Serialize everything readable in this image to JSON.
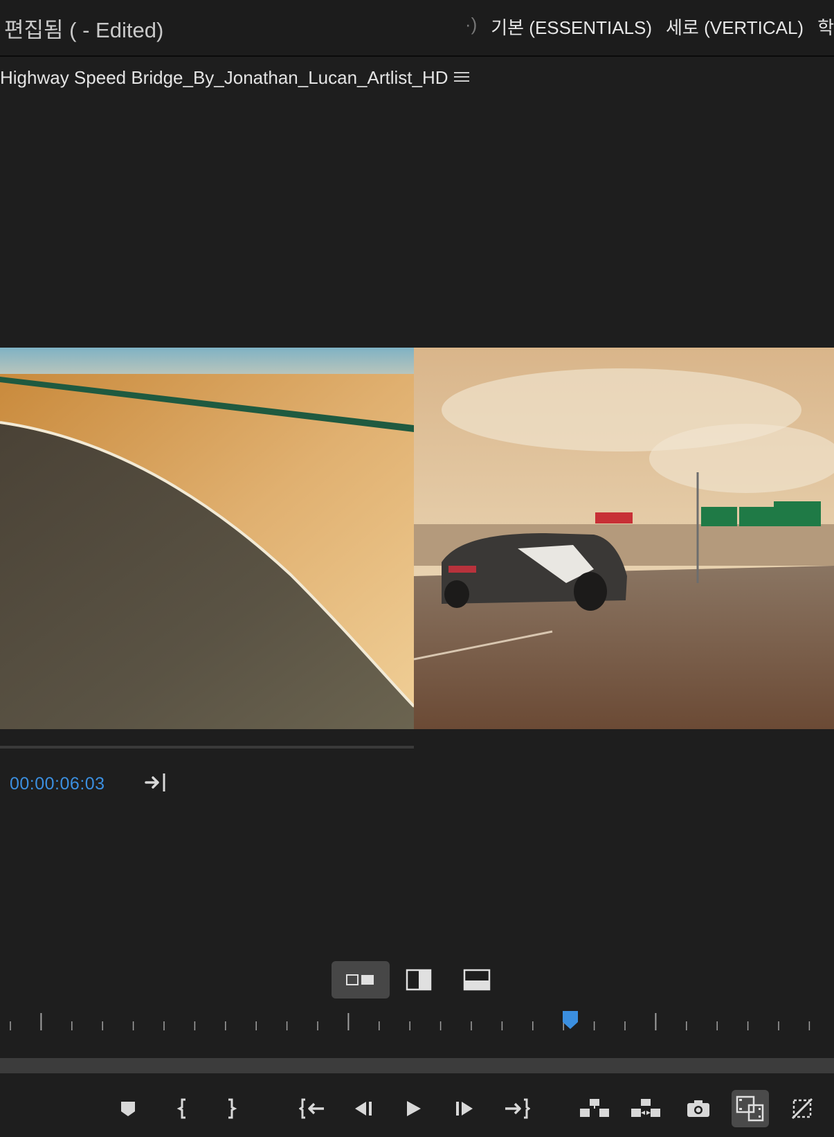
{
  "header": {
    "doc_title": "편집됨 ( - Edited)",
    "workspace_partial": "·)",
    "workspaces": [
      {
        "label": "기본 (ESSENTIALS)"
      },
      {
        "label": "세로 (VERTICAL)"
      },
      {
        "label": "학"
      }
    ]
  },
  "clip": {
    "name": "Highway Speed Bridge_By_Jonathan_Lucan_Artlist_HD"
  },
  "monitor": {
    "timecode": "00:00:06:03",
    "timecode_color": "#3b8fe0",
    "playhead_position": 0.685
  },
  "view_modes": [
    {
      "icon": "side-by-side-icon",
      "active": true
    },
    {
      "icon": "vertical-split-icon",
      "active": false
    },
    {
      "icon": "horizontal-split-icon",
      "active": false
    }
  ],
  "transport": [
    {
      "icon": "add-marker-icon"
    },
    {
      "icon": "mark-in-icon"
    },
    {
      "icon": "mark-out-icon"
    },
    {
      "icon": "go-to-in-icon"
    },
    {
      "icon": "step-back-icon"
    },
    {
      "icon": "play-icon"
    },
    {
      "icon": "step-forward-icon"
    },
    {
      "icon": "go-to-out-icon"
    },
    {
      "icon": "lift-icon"
    },
    {
      "icon": "extract-icon"
    },
    {
      "icon": "export-frame-icon"
    },
    {
      "icon": "comparison-view-icon",
      "active": true
    },
    {
      "icon": "toggle-proxies-icon"
    }
  ],
  "colors": {
    "background": "#1e1e1e",
    "accent": "#3b8fe0",
    "active_button": "#474747"
  }
}
